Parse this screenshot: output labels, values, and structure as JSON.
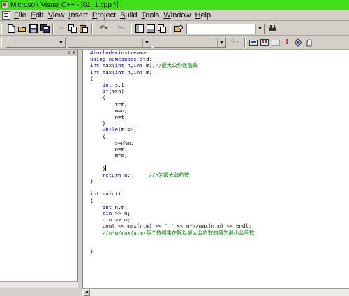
{
  "window": {
    "title": "Microsoft Visual C++ - [01_1.cpp *]"
  },
  "menu": [
    {
      "label": "File",
      "key": "F",
      "rest": "ile"
    },
    {
      "label": "Edit",
      "key": "E",
      "rest": "dit"
    },
    {
      "label": "View",
      "key": "V",
      "rest": "iew"
    },
    {
      "label": "Insert",
      "key": "I",
      "rest": "nsert"
    },
    {
      "label": "Project",
      "key": "P",
      "rest": "roject"
    },
    {
      "label": "Build",
      "key": "B",
      "rest": "uild"
    },
    {
      "label": "Tools",
      "key": "T",
      "rest": "ools"
    },
    {
      "label": "Window",
      "key": "W",
      "rest": "indow"
    },
    {
      "label": "Help",
      "key": "H",
      "rest": "elp"
    }
  ],
  "toolbar": {
    "find_combo_value": "",
    "workspace_combo_value": "",
    "class_combo_value": "",
    "member_combo_value": ""
  },
  "workspace": {
    "header_glyphs": [
      "x",
      "x"
    ]
  },
  "code_lines": [
    "#include<iostream>",
    "using namespace std;",
    "int max(int n,int m);//最大公约数函数",
    "int max(int n,int m)",
    "{",
    "    int s,t;",
    "    if(m>n)",
    "    {",
    "        t=m;",
    "        m=n;",
    "        n=t;",
    "    }",
    "    while(m!=0)",
    "    {",
    "        s=n%m;",
    "        n=m;",
    "        m=s;",
    "",
    "    }",
    "    return n;      //n为最大公约数",
    "}",
    "",
    "int main()",
    "{",
    "    int n,m;",
    "    cin >> n;",
    "    cin >> m;",
    "    cout << max(n,m) << ' ' << n*m/max(n,m) << endl;",
    "    //n*m/max(n,m)两个数相乘在除以最大公约数的值为最小公倍数",
    "",
    "",
    "}"
  ],
  "colors": {
    "title_bar": "#3fe017",
    "keyword": "#0000cc",
    "comment": "#008000",
    "chrome": "#d4d0c8"
  },
  "icons": {
    "toolbar1": [
      "new-file-icon",
      "open-icon",
      "save-icon",
      "save-all-icon",
      "cut-icon",
      "copy-icon",
      "paste-icon",
      "undo-icon",
      "redo-icon",
      "workspace-icon",
      "output-icon",
      "window-list-icon",
      "find-in-files-icon",
      "find-icon"
    ],
    "toolbar2": [
      "wizard-icon",
      "compile-icon",
      "build-icon",
      "stop-build-icon",
      "execute-icon",
      "go-icon",
      "breakpoint-icon"
    ]
  }
}
